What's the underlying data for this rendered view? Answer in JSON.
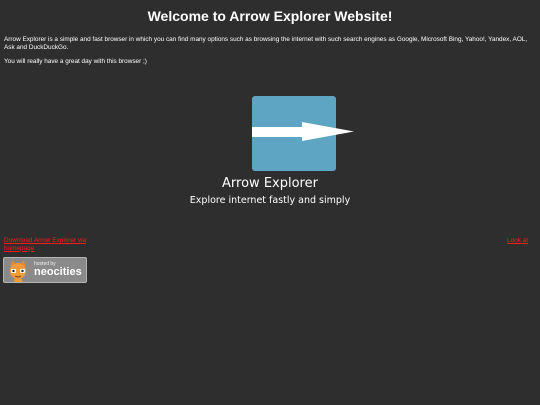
{
  "header": {
    "title": "Welcome to Arrow Explorer Website!"
  },
  "content": {
    "intro": "Arrow Explorer is a simple and fast browser in which you can find many options such as browsing the internet with such search engines as Google, Microsoft Bing, Yahoo!, Yandex, AOL, Ask and DuckDuckGo.",
    "note": "You will really have a great day with this browser ;)"
  },
  "logo": {
    "icon": "arrow-right-icon",
    "box_color": "#5ea4c3",
    "app_name": "Arrow Explorer",
    "tagline": "Explore internet fastly and simply"
  },
  "links": {
    "download": "Download Arrow Explorer via homepage",
    "look": "Look at",
    "color": "#ff1a1a"
  },
  "badge": {
    "hosted_by": "hosted by",
    "name": "neocities",
    "icon": "neocities-cat-icon"
  }
}
